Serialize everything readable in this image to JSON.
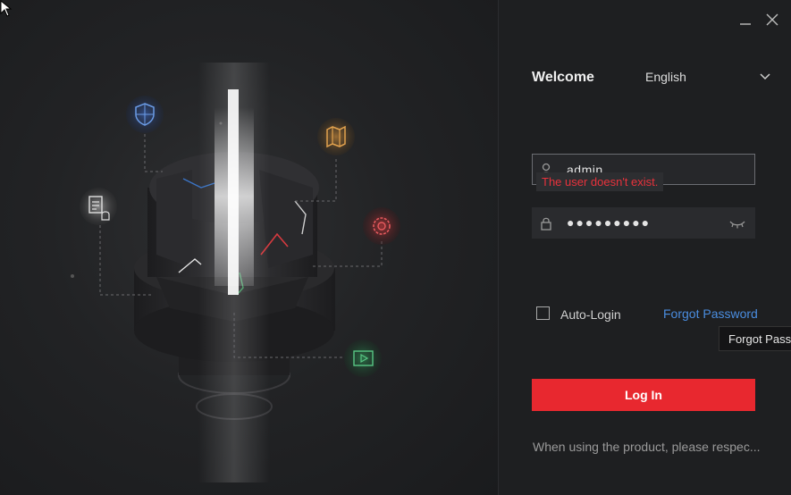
{
  "window": {
    "minimize_icon": "minimize-icon",
    "close_icon": "close-icon"
  },
  "login": {
    "welcome": "Welcome",
    "language": "English",
    "username_value": "admin",
    "username_error": "The user doesn't exist.",
    "password_mask": "●●●●●●●●●",
    "auto_login_label": "Auto-Login",
    "auto_login_checked": false,
    "forgot_password": "Forgot Password",
    "forgot_tooltip": "Forgot Pass",
    "login_button": "Log In",
    "notice": "When using the product, please respec..."
  },
  "colors": {
    "accent_red": "#e8282f",
    "link_blue": "#4a8de0",
    "error_red": "#e8323c"
  },
  "illustration": {
    "icons": [
      "shield-icon",
      "map-icon",
      "document-alarm-icon",
      "settings-gear-icon",
      "video-play-icon"
    ]
  }
}
